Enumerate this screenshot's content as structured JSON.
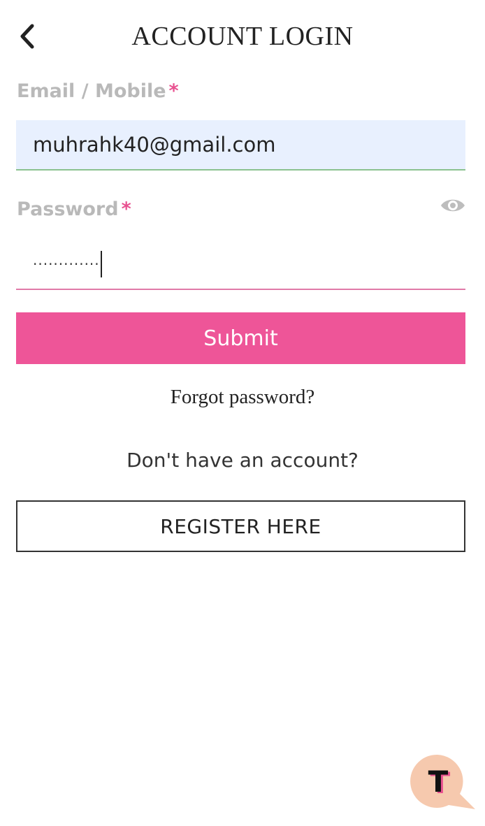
{
  "header": {
    "title": "ACCOUNT LOGIN",
    "back_icon": "chevron-left-icon"
  },
  "form": {
    "email": {
      "label": "Email / Mobile",
      "required_mark": "*",
      "value": "muhrahk40@gmail.com"
    },
    "password": {
      "label": "Password",
      "required_mark": "*",
      "masked_value": "·············",
      "toggle_icon": "eye-icon"
    },
    "submit_label": "Submit",
    "forgot_label": "Forgot password?",
    "no_account_text": "Don't have an account?",
    "register_label": "REGISTER HERE"
  },
  "chat_fab": {
    "letter": "T",
    "icon": "chat-bubble-icon"
  },
  "colors": {
    "accent": "#ee5598",
    "required": "#e8508f",
    "email_fill": "#e8f0fe",
    "email_underline": "#8bc28f",
    "password_underline": "#e07aa8",
    "label_gray": "#b9b9b9",
    "fab_bg": "#f6c9ae"
  }
}
